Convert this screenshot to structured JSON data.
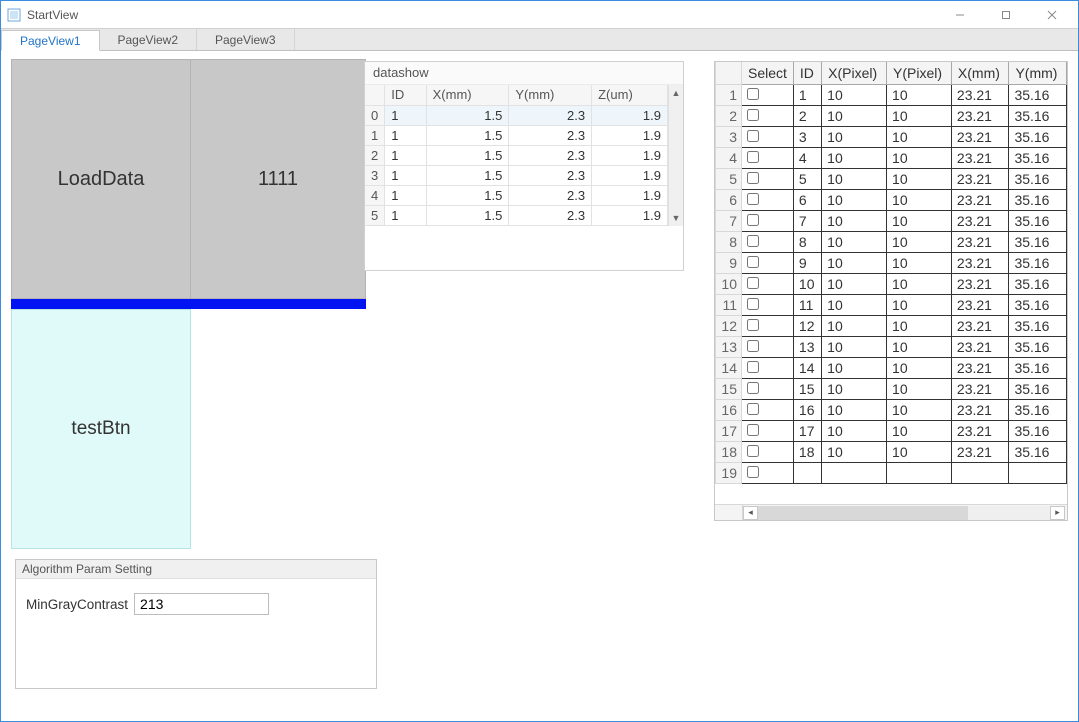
{
  "window": {
    "title": "StartView"
  },
  "win_buttons": {
    "minimize": "min",
    "maximize": "max",
    "close": "close"
  },
  "tabs": [
    {
      "label": "PageView1",
      "active": true
    },
    {
      "label": "PageView2",
      "active": false
    },
    {
      "label": "PageView3",
      "active": false
    }
  ],
  "buttons": {
    "load_label": "LoadData",
    "num_label": "1111",
    "test_label": "testBtn"
  },
  "datashow": {
    "title": "datashow",
    "columns": [
      "ID",
      "X(mm)",
      "Y(mm)",
      "Z(um)"
    ],
    "rows": [
      {
        "idx": "0",
        "id": "1",
        "x": "1.5",
        "y": "2.3",
        "z": "1.9",
        "selected": true
      },
      {
        "idx": "1",
        "id": "1",
        "x": "1.5",
        "y": "2.3",
        "z": "1.9",
        "selected": false
      },
      {
        "idx": "2",
        "id": "1",
        "x": "1.5",
        "y": "2.3",
        "z": "1.9",
        "selected": false
      },
      {
        "idx": "3",
        "id": "1",
        "x": "1.5",
        "y": "2.3",
        "z": "1.9",
        "selected": false
      },
      {
        "idx": "4",
        "id": "1",
        "x": "1.5",
        "y": "2.3",
        "z": "1.9",
        "selected": false
      },
      {
        "idx": "5",
        "id": "1",
        "x": "1.5",
        "y": "2.3",
        "z": "1.9",
        "selected": false
      }
    ]
  },
  "grid": {
    "columns": [
      "Select",
      "ID",
      "X(Pixel)",
      "Y(Pixel)",
      "X(mm)",
      "Y(mm)"
    ],
    "rows": [
      {
        "n": "1",
        "id": "1",
        "xp": "10",
        "yp": "10",
        "xm": "23.21",
        "ym": "35.16"
      },
      {
        "n": "2",
        "id": "2",
        "xp": "10",
        "yp": "10",
        "xm": "23.21",
        "ym": "35.16"
      },
      {
        "n": "3",
        "id": "3",
        "xp": "10",
        "yp": "10",
        "xm": "23.21",
        "ym": "35.16"
      },
      {
        "n": "4",
        "id": "4",
        "xp": "10",
        "yp": "10",
        "xm": "23.21",
        "ym": "35.16"
      },
      {
        "n": "5",
        "id": "5",
        "xp": "10",
        "yp": "10",
        "xm": "23.21",
        "ym": "35.16"
      },
      {
        "n": "6",
        "id": "6",
        "xp": "10",
        "yp": "10",
        "xm": "23.21",
        "ym": "35.16"
      },
      {
        "n": "7",
        "id": "7",
        "xp": "10",
        "yp": "10",
        "xm": "23.21",
        "ym": "35.16"
      },
      {
        "n": "8",
        "id": "8",
        "xp": "10",
        "yp": "10",
        "xm": "23.21",
        "ym": "35.16"
      },
      {
        "n": "9",
        "id": "9",
        "xp": "10",
        "yp": "10",
        "xm": "23.21",
        "ym": "35.16"
      },
      {
        "n": "10",
        "id": "10",
        "xp": "10",
        "yp": "10",
        "xm": "23.21",
        "ym": "35.16"
      },
      {
        "n": "11",
        "id": "11",
        "xp": "10",
        "yp": "10",
        "xm": "23.21",
        "ym": "35.16"
      },
      {
        "n": "12",
        "id": "12",
        "xp": "10",
        "yp": "10",
        "xm": "23.21",
        "ym": "35.16"
      },
      {
        "n": "13",
        "id": "13",
        "xp": "10",
        "yp": "10",
        "xm": "23.21",
        "ym": "35.16"
      },
      {
        "n": "14",
        "id": "14",
        "xp": "10",
        "yp": "10",
        "xm": "23.21",
        "ym": "35.16"
      },
      {
        "n": "15",
        "id": "15",
        "xp": "10",
        "yp": "10",
        "xm": "23.21",
        "ym": "35.16"
      },
      {
        "n": "16",
        "id": "16",
        "xp": "10",
        "yp": "10",
        "xm": "23.21",
        "ym": "35.16"
      },
      {
        "n": "17",
        "id": "17",
        "xp": "10",
        "yp": "10",
        "xm": "23.21",
        "ym": "35.16"
      },
      {
        "n": "18",
        "id": "18",
        "xp": "10",
        "yp": "10",
        "xm": "23.21",
        "ym": "35.16"
      },
      {
        "n": "19",
        "id": "",
        "xp": "",
        "yp": "",
        "xm": "",
        "ym": ""
      }
    ]
  },
  "algorithm": {
    "title": "Algorithm Param Setting",
    "param_label": "MinGrayContrast",
    "param_value": "213"
  }
}
